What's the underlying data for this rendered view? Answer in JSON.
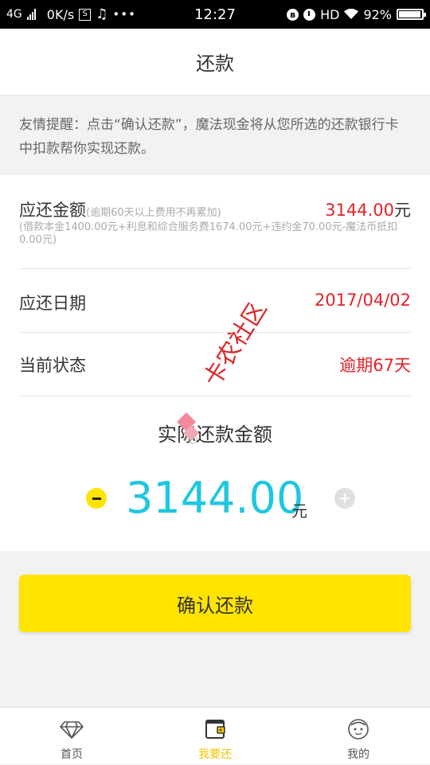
{
  "status_bar": {
    "network": "4G",
    "speed": "0K/s",
    "time": "12:27",
    "hd": "HD",
    "battery": "92%"
  },
  "header": {
    "title": "还款"
  },
  "notice": {
    "text": "友情提醒：点击“确认还款”，魔法现金将从您所选的还款银行卡中扣款帮你实现还款。"
  },
  "amount_due": {
    "label": "应还金额",
    "note": "(逾期60天以上费用不再累加)",
    "value": "3144.00",
    "unit": "元",
    "detail": "(借款本金1400.00元+利息和综合服务费1674.00元+违约金70.00元-魔法币抵扣0.00元)"
  },
  "due_date": {
    "label": "应还日期",
    "value": "2017/04/02"
  },
  "status": {
    "label": "当前状态",
    "value": "逾期67天"
  },
  "actual": {
    "title": "实际还款金额",
    "amount": "3144.00",
    "unit": "元"
  },
  "confirm_button": {
    "label": "确认还款"
  },
  "watermark": {
    "text": "卡农社区"
  },
  "tabs": [
    {
      "label": "首页",
      "icon": "diamond-icon",
      "active": false
    },
    {
      "label": "我要还",
      "icon": "wallet-icon",
      "active": true
    },
    {
      "label": "我的",
      "icon": "face-icon",
      "active": false
    }
  ],
  "colors": {
    "accent": "#ffe400",
    "amount": "#1fc6e0",
    "alert": "#e2232a",
    "active_tab": "#f4c300"
  }
}
